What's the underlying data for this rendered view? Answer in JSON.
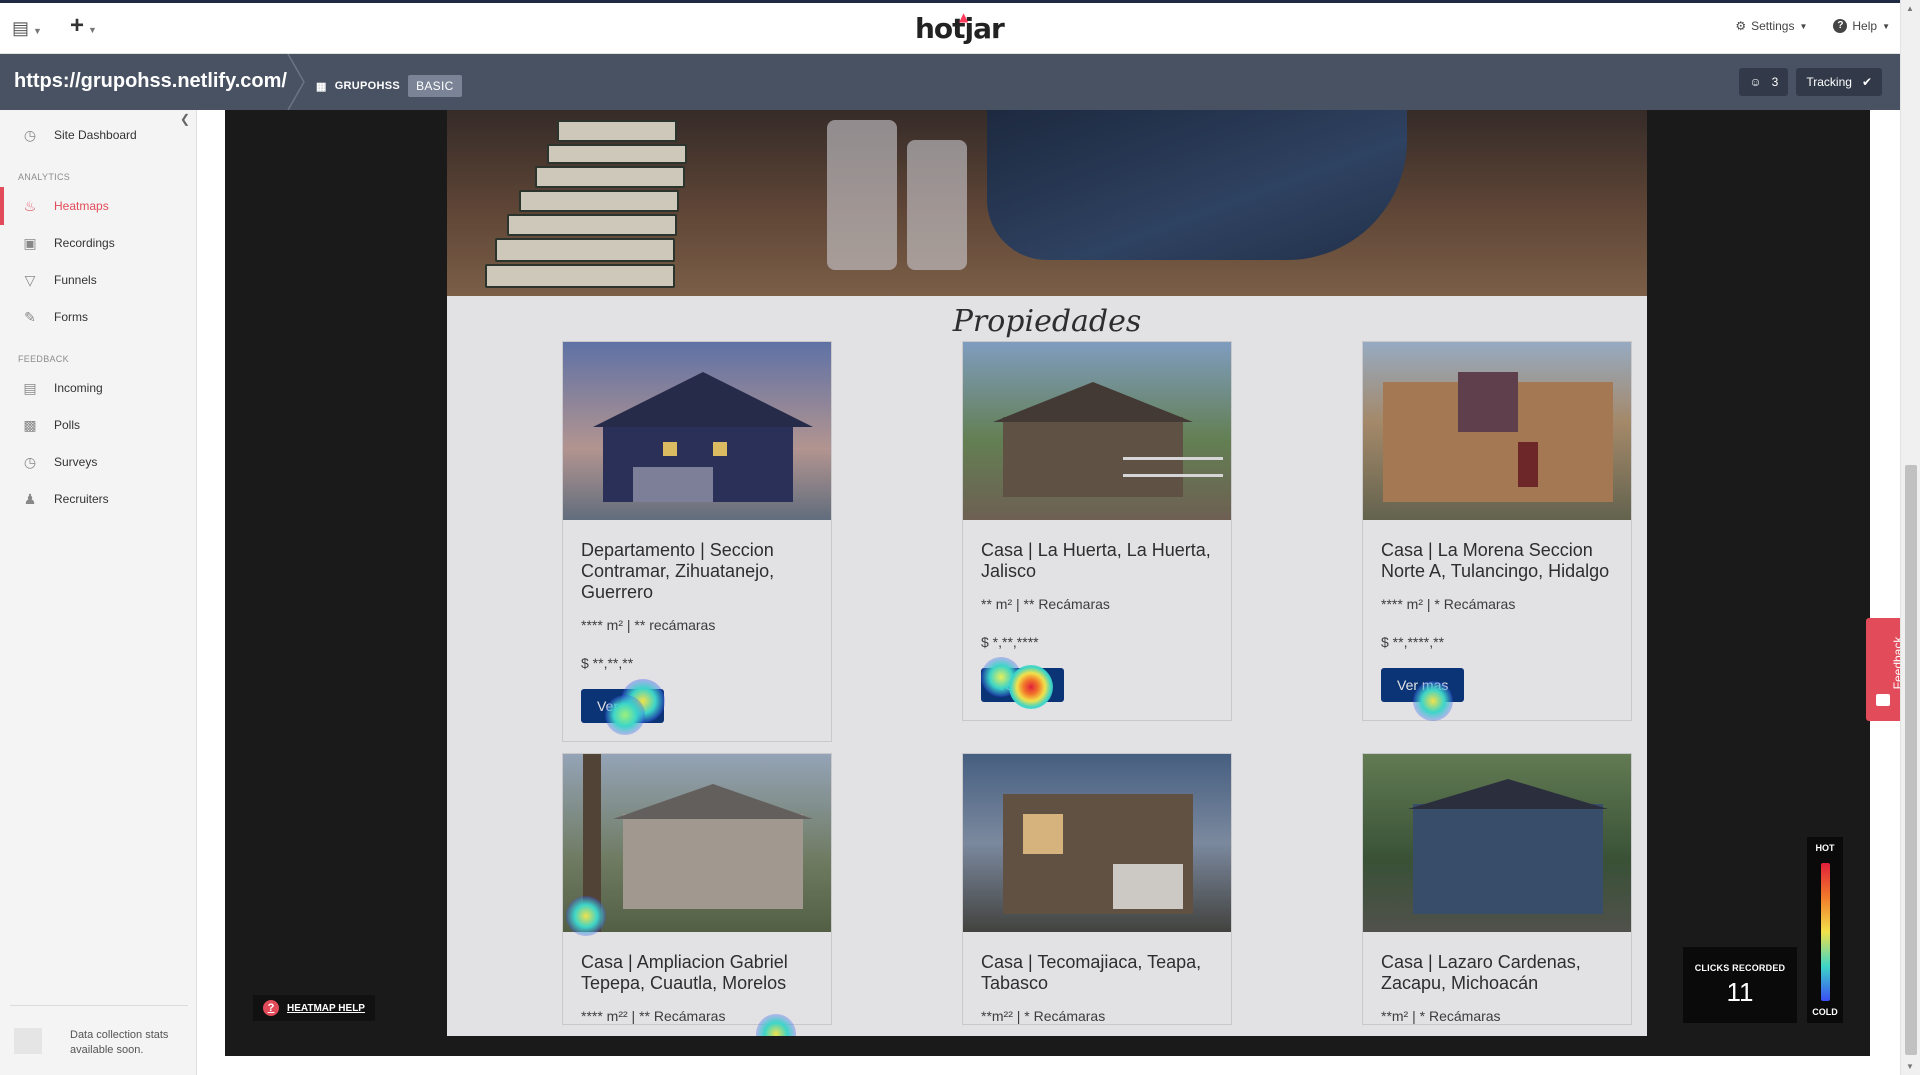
{
  "topbar": {
    "logo": "hotjar",
    "settings_label": "Settings",
    "help_label": "Help"
  },
  "sitebar": {
    "url": "https://grupohss.netlify.com/",
    "org": "GRUPOHSS",
    "plan": "BASIC",
    "users_count": "3",
    "tracking_label": "Tracking"
  },
  "sidebar": {
    "dashboard": "Site Dashboard",
    "analytics_section": "ANALYTICS",
    "heatmaps": "Heatmaps",
    "recordings": "Recordings",
    "funnels": "Funnels",
    "forms": "Forms",
    "feedback_section": "FEEDBACK",
    "incoming": "Incoming",
    "polls": "Polls",
    "surveys": "Surveys",
    "recruiters": "Recruiters",
    "footer_text": "Data collection stats available soon."
  },
  "site": {
    "heading": "Propiedades",
    "cards": [
      {
        "title": "Departamento | Seccion Contramar, Zihuatanejo, Guerrero",
        "meta": "**** m² | ** recámaras",
        "price": "$ **,**,**",
        "button": "Ver mas"
      },
      {
        "title": "Casa | La Huerta, La Huerta, Jalisco",
        "meta": "** m² | ** Recámaras",
        "price": "$ *,**,****",
        "button": "Ver mas"
      },
      {
        "title": "Casa | La Morena Seccion Norte A, Tulancingo, Hidalgo",
        "meta": "**** m² | * Recámaras",
        "price": "$ **,****,**",
        "button": "Ver mas"
      },
      {
        "title": "Casa | Ampliacion Gabriel Tepepa, Cuautla, Morelos",
        "meta": "**** m²² | ** Recámaras"
      },
      {
        "title": "Casa | Tecomajiaca, Teapa, Tabasco",
        "meta": "**m²² | * Recámaras"
      },
      {
        "title": "Casa | Lazaro Cardenas, Zacapu, Michoacán",
        "meta": "**m² | * Recámaras"
      }
    ]
  },
  "heatmap": {
    "help_label": "HEATMAP HELP",
    "clicks_label": "CLICKS RECORDED",
    "clicks_value": "11",
    "legend_hot": "HOT",
    "legend_cold": "COLD",
    "feedback_label": "Feedback",
    "colors": {
      "hot": "#e0203a",
      "warm": "#f2e14a",
      "cool": "#3dd5c8",
      "cold": "#3a4df5"
    }
  },
  "icons": [
    "dashboard-icon",
    "flame-icon",
    "recordings-icon",
    "funnel-icon",
    "forms-icon",
    "incoming-icon",
    "polls-icon",
    "surveys-icon",
    "recruiters-icon",
    "gear-icon",
    "help-icon",
    "users-icon",
    "check-icon"
  ]
}
